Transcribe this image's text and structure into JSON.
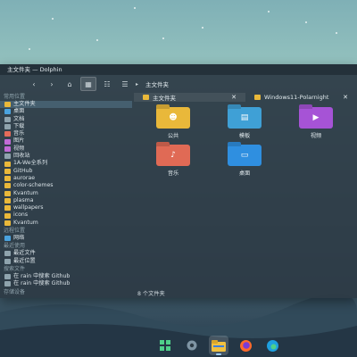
{
  "window": {
    "title": "主文件夹 — Dolphin"
  },
  "toolbar": {
    "breadcrumb_sep": "▸",
    "breadcrumb": "主文件夹"
  },
  "sidebar": {
    "sections": {
      "places": "常用位置",
      "remote": "远程位置",
      "recent": "最近使用",
      "search": "搜索文件",
      "devices": "存储设备"
    },
    "places": [
      {
        "label": "主文件夹",
        "icon": "home-folder-icon"
      },
      {
        "label": "桌面",
        "icon": "desktop-folder-icon"
      },
      {
        "label": "文档",
        "icon": "documents-folder-icon"
      },
      {
        "label": "下载",
        "icon": "downloads-folder-icon"
      },
      {
        "label": "音乐",
        "icon": "music-folder-icon"
      },
      {
        "label": "图片",
        "icon": "pictures-folder-icon"
      },
      {
        "label": "视频",
        "icon": "videos-folder-icon"
      },
      {
        "label": "回收站",
        "icon": "trash-icon"
      },
      {
        "label": "1A-We全系列",
        "icon": "folder-icon"
      },
      {
        "label": "GitHub",
        "icon": "folder-icon"
      },
      {
        "label": "aurorae",
        "icon": "folder-icon"
      },
      {
        "label": "color-schemes",
        "icon": "folder-icon"
      },
      {
        "label": "Kvantum",
        "icon": "folder-icon"
      },
      {
        "label": "plasma",
        "icon": "folder-icon"
      },
      {
        "label": "wallpapers",
        "icon": "folder-icon"
      },
      {
        "label": "icons",
        "icon": "folder-icon"
      },
      {
        "label": "Kvantum",
        "icon": "folder-icon"
      }
    ],
    "remote": [
      {
        "label": "网络",
        "icon": "network-icon"
      }
    ],
    "recent": [
      {
        "label": "最近文件",
        "icon": "recent-files-icon"
      },
      {
        "label": "最近位置",
        "icon": "recent-locations-icon"
      }
    ],
    "search": [
      {
        "label": "在 rain 中搜索 Github",
        "icon": "search-icon"
      },
      {
        "label": "在 rain 中搜索 Github",
        "icon": "search-icon"
      }
    ]
  },
  "tabs": [
    {
      "label": "主文件夹",
      "close": "✕"
    },
    {
      "label": "Windows11-Polarnight",
      "close": "✕"
    }
  ],
  "files": [
    {
      "label": "公共",
      "color": "#e9b83a",
      "emblem": "person-icon"
    },
    {
      "label": "模板",
      "color": "#3fa0d6",
      "emblem": "templates-icon"
    },
    {
      "label": "视频",
      "color": "#a653d6",
      "emblem": "video-icon"
    },
    {
      "label": "音乐",
      "color": "#e06a55",
      "emblem": "music-note-icon"
    },
    {
      "label": "桌面",
      "color": "#2f8fe0",
      "emblem": "desktop-icon"
    }
  ],
  "status": {
    "text": "8 个文件夹"
  },
  "taskbar": [
    {
      "name": "start-menu-icon"
    },
    {
      "name": "settings-icon"
    },
    {
      "name": "file-manager-icon",
      "active": true
    },
    {
      "name": "firefox-icon"
    },
    {
      "name": "edge-browser-icon"
    }
  ]
}
